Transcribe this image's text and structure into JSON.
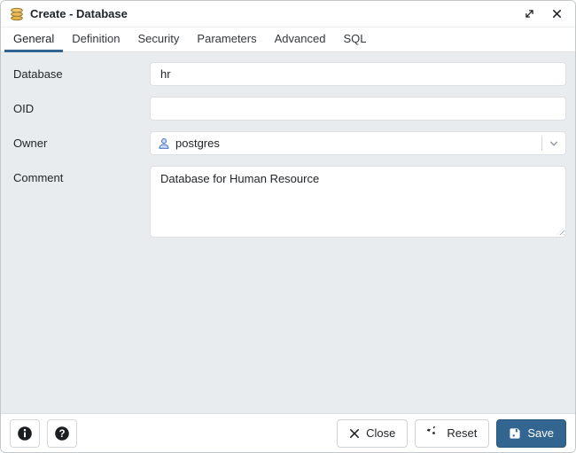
{
  "dialog": {
    "title": "Create - Database"
  },
  "tabs": [
    {
      "label": "General",
      "active": true
    },
    {
      "label": "Definition",
      "active": false
    },
    {
      "label": "Security",
      "active": false
    },
    {
      "label": "Parameters",
      "active": false
    },
    {
      "label": "Advanced",
      "active": false
    },
    {
      "label": "SQL",
      "active": false
    }
  ],
  "form": {
    "database": {
      "label": "Database",
      "value": "hr"
    },
    "oid": {
      "label": "OID",
      "value": ""
    },
    "owner": {
      "label": "Owner",
      "value": "postgres",
      "icon": "user-icon"
    },
    "comment": {
      "label": "Comment",
      "value": "Database for Human Resource"
    }
  },
  "footer": {
    "close_label": "Close",
    "reset_label": "Reset",
    "save_label": "Save"
  },
  "icons": {
    "title": "database-coins-icon",
    "window": [
      "maximize-icon",
      "close-icon"
    ],
    "footer_left": [
      "info-icon",
      "help-icon"
    ]
  },
  "colors": {
    "accent_blue": "#326690",
    "content_bg": "#e9ecef",
    "coin_gold": "#e3b34d",
    "owner_icon_stroke": "#4b79c4",
    "owner_icon_fill": "#cfdef5"
  }
}
